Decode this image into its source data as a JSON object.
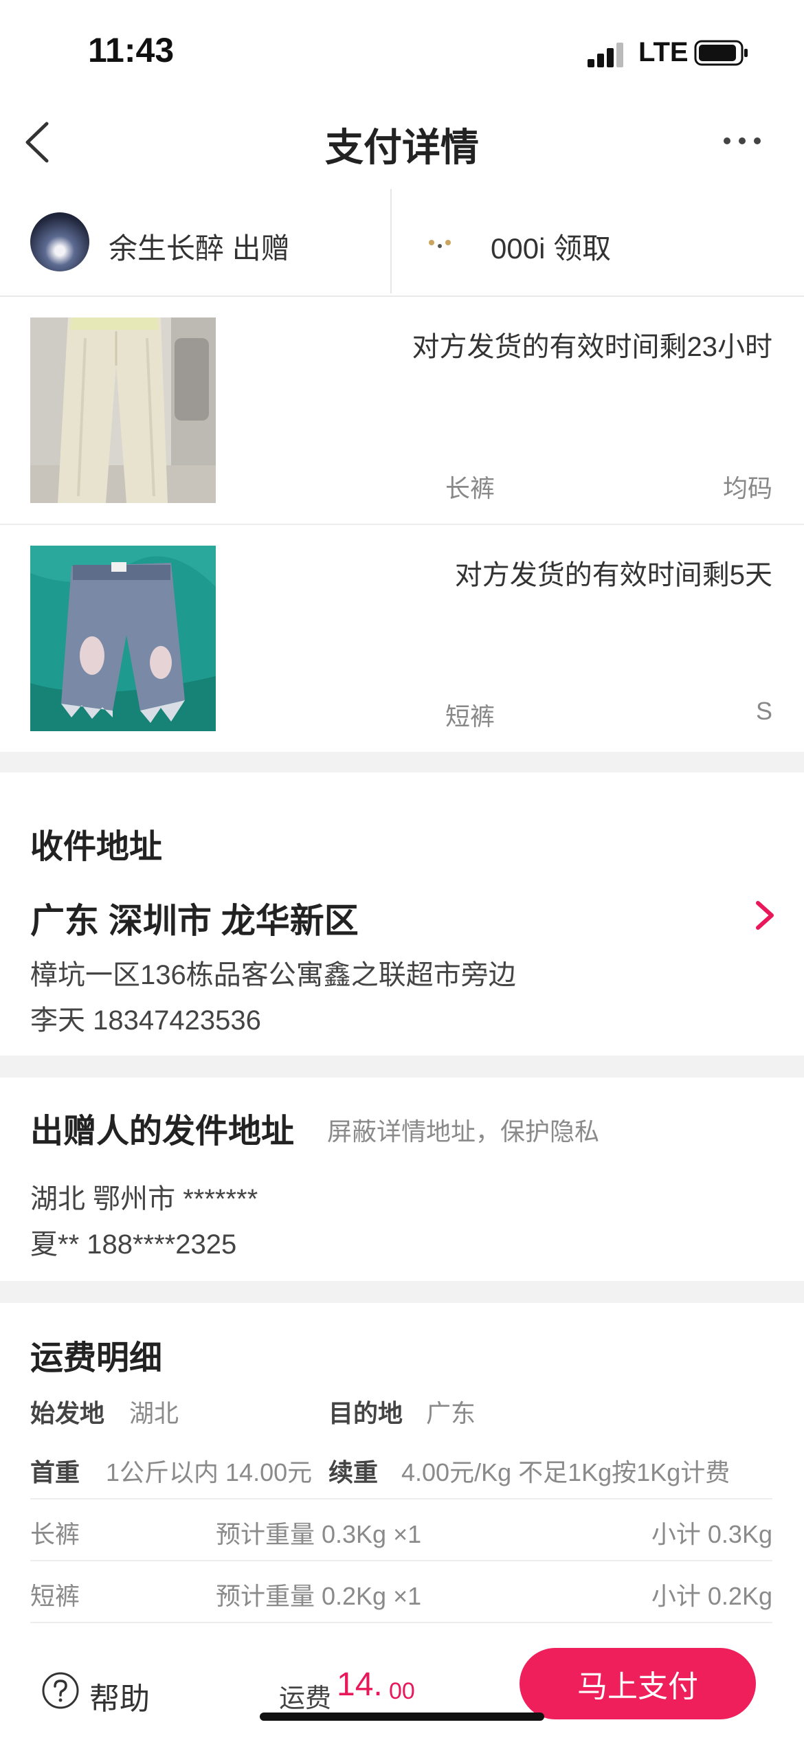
{
  "status_bar": {
    "time": "11:43",
    "network": "LTE"
  },
  "nav": {
    "title": "支付详情"
  },
  "users": {
    "giver": "余生长醉 出赠",
    "receiver": "000i 领取"
  },
  "items": [
    {
      "time_left": "对方发货的有效时间剩23小时",
      "name": "长裤",
      "size": "均码"
    },
    {
      "time_left": "对方发货的有效时间剩5天",
      "name": "短裤",
      "size": "S"
    }
  ],
  "recipient_address": {
    "title": "收件地址",
    "region": "广东 深圳市 龙华新区",
    "street": "樟坑一区136栋品客公寓鑫之联超市旁边",
    "contact": "李天 18347423536"
  },
  "sender_address": {
    "title": "出赠人的发件地址",
    "note": "屏蔽详情地址，保护隐私",
    "region": "湖北 鄂州市 *******",
    "contact": "夏** 188****2325"
  },
  "shipping": {
    "title": "运费明细",
    "origin_label": "始发地",
    "origin": "湖北",
    "dest_label": "目的地",
    "dest": "广东",
    "first_weight_label": "首重",
    "first_weight": "1公斤以内 14.00元",
    "extra_weight_label": "续重",
    "extra_weight": "4.00元/Kg 不足1Kg按1Kg计费",
    "rows": [
      {
        "name": "长裤",
        "estimate": "预计重量 0.3Kg ×1",
        "subtotal": "小计 0.3Kg"
      },
      {
        "name": "短裤",
        "estimate": "预计重量 0.2Kg ×1",
        "subtotal": "小计 0.2Kg"
      }
    ]
  },
  "bottom": {
    "help": "帮助",
    "fee_label": "运费",
    "fee_int": "14.",
    "fee_dec": "00",
    "pay_button": "马上支付"
  },
  "colors": {
    "accent": "#ee1f5b",
    "divider": "#f2f2f2"
  }
}
